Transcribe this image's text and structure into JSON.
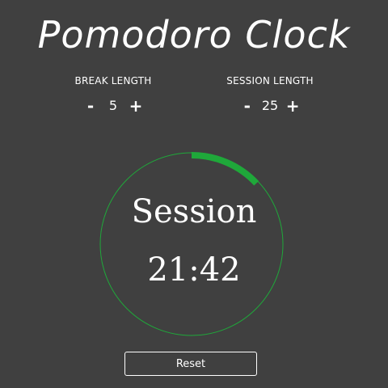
{
  "app": {
    "title": "Pomodoro Clock"
  },
  "break_length": {
    "label": "BREAK LENGTH",
    "decrement": "-",
    "value": "5",
    "increment": "+"
  },
  "session_length": {
    "label": "SESSION LENGTH",
    "decrement": "-",
    "value": "25",
    "increment": "+"
  },
  "timer": {
    "mode": "Session",
    "time": "21:42",
    "progress_fraction": 0.13,
    "track_color": "#1fa83a",
    "progress_color": "#1fa83a"
  },
  "controls": {
    "reset_label": "Reset"
  }
}
